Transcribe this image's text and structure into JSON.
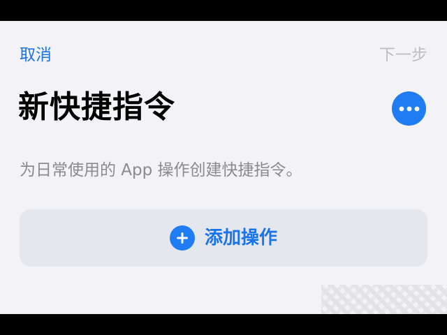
{
  "nav": {
    "cancel_label": "取消",
    "next_label": "下一步"
  },
  "page": {
    "title": "新快捷指令",
    "description": "为日常使用的 App 操作创建快捷指令。"
  },
  "action": {
    "add_label": "添加操作"
  },
  "icons": {
    "more": "ellipsis-icon",
    "add": "plus-icon"
  },
  "colors": {
    "accent": "#1f7cf2",
    "link": "#1a73e8",
    "disabled": "#bcbcc2",
    "background": "#f2f2f7",
    "card": "#e4e8ee"
  }
}
